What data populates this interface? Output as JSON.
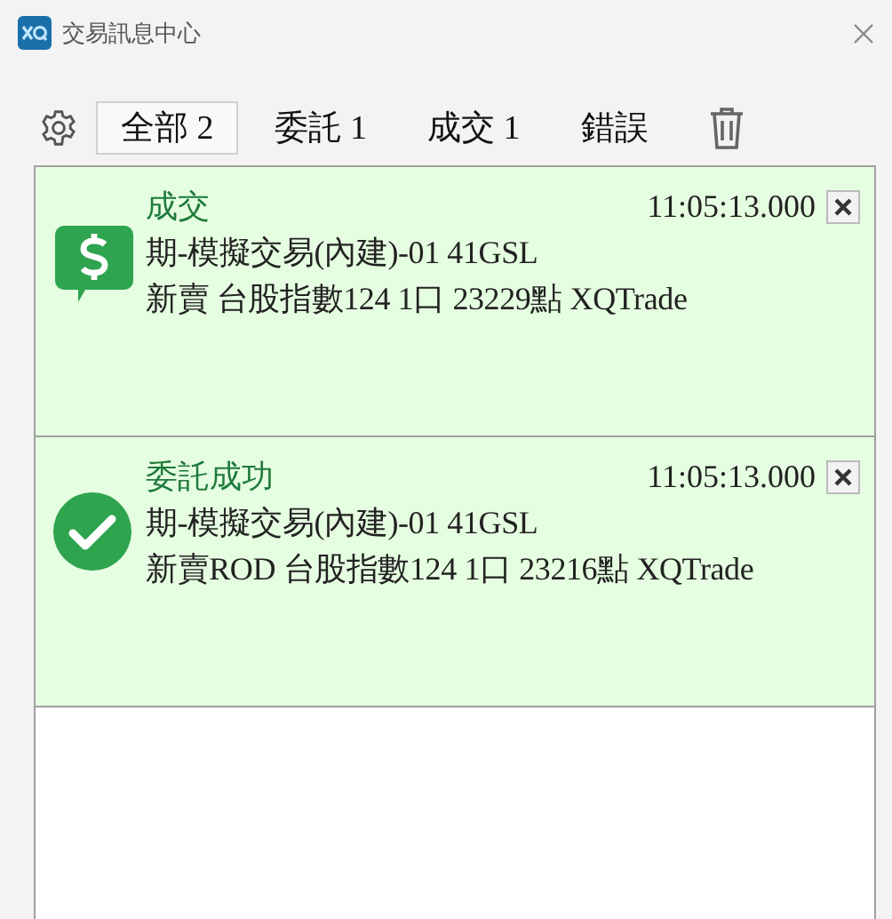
{
  "window": {
    "title": "交易訊息中心"
  },
  "tabs": [
    {
      "label": "全部 2",
      "selected": true
    },
    {
      "label": "委託 1",
      "selected": false
    },
    {
      "label": "成交 1",
      "selected": false
    },
    {
      "label": "錯誤",
      "selected": false
    }
  ],
  "messages": [
    {
      "kind": "deal",
      "title": "成交",
      "time": "11:05:13.000",
      "lines": [
        "期-模擬交易(內建)-01 41GSL",
        "新賣 台股指數124 1口 23229點 XQTrade"
      ]
    },
    {
      "kind": "order",
      "title": "委託成功",
      "time": "11:05:13.000",
      "lines": [
        "期-模擬交易(內建)-01 41GSL",
        "新賣ROD 台股指數124 1口 23216點 XQTrade"
      ]
    }
  ]
}
